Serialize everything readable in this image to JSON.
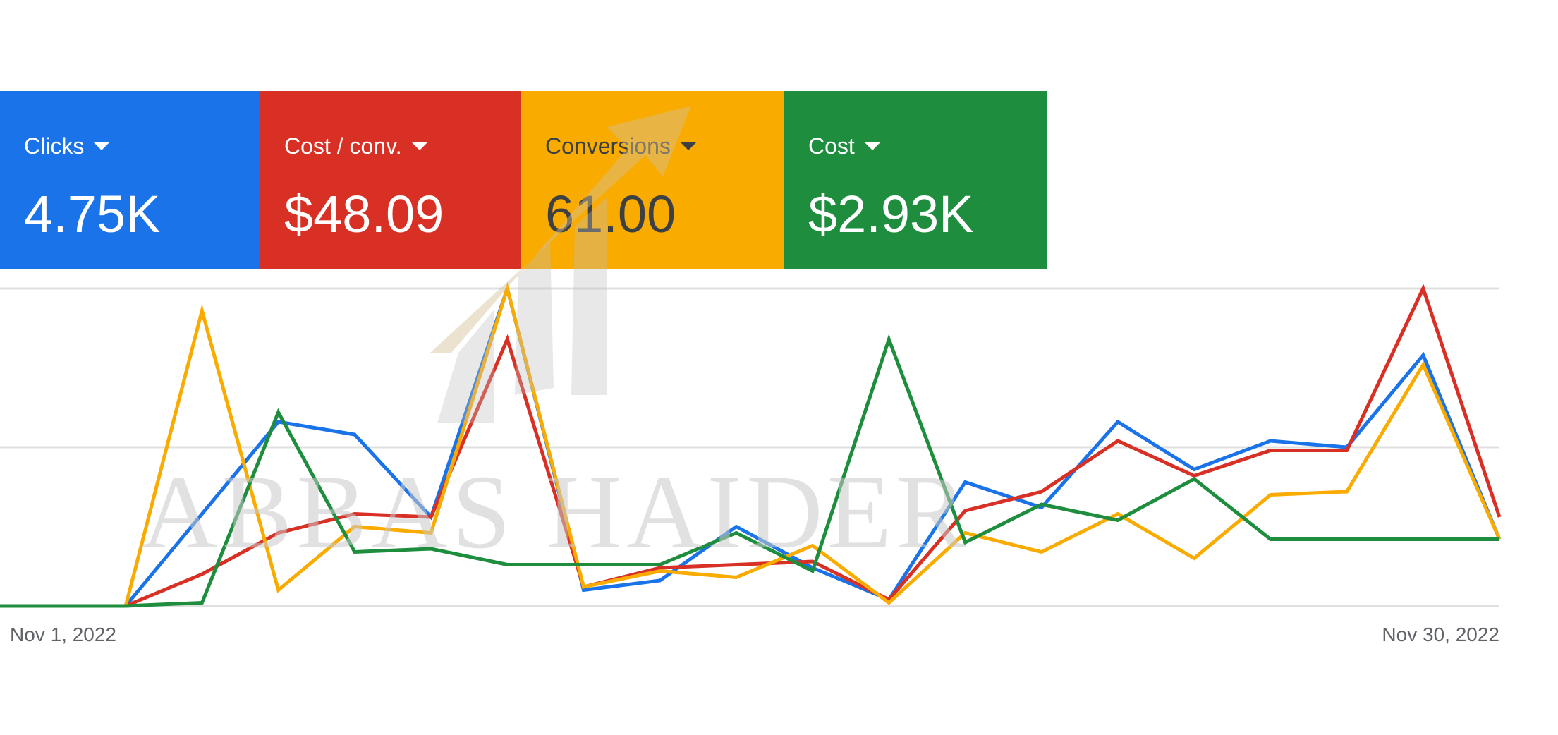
{
  "scorecards": [
    {
      "label": "Clicks",
      "value": "4.75K",
      "color": "#1a73e8",
      "text": "light"
    },
    {
      "label": "Cost / conv.",
      "value": "$48.09",
      "color": "#d93025",
      "text": "light"
    },
    {
      "label": "Conversions",
      "value": "61.00",
      "color": "#f9ab00",
      "text": "dark"
    },
    {
      "label": "Cost",
      "value": "$2.93K",
      "color": "#1e8e3e",
      "text": "light"
    }
  ],
  "watermark": "ABBAS HAIDER",
  "chart_data": {
    "type": "line",
    "x_start_label": "Nov 1, 2022",
    "x_end_label": "Nov 30, 2022",
    "ylim": [
      0,
      100
    ],
    "grid": true,
    "series": [
      {
        "color": "#1a73e8",
        "values": [
          0,
          0,
          29,
          58,
          54,
          28,
          100,
          5,
          8,
          25,
          12,
          2,
          39,
          31,
          58,
          43,
          52,
          50,
          79,
          21
        ]
      },
      {
        "color": "#d93025",
        "values": [
          0,
          0,
          10,
          23,
          29,
          28,
          84,
          6,
          12,
          13,
          14,
          2,
          30,
          36,
          52,
          41,
          49,
          49,
          100,
          28
        ]
      },
      {
        "color": "#f9ab00",
        "values": [
          0,
          0,
          93,
          5,
          25,
          23,
          100,
          6,
          11,
          9,
          19,
          1,
          23,
          17,
          29,
          15,
          35,
          36,
          76,
          21
        ]
      },
      {
        "color": "#1e8e3e",
        "values": [
          0,
          0,
          1,
          61,
          17,
          18,
          13,
          13,
          13,
          23,
          11,
          84,
          20,
          32,
          27,
          40,
          21,
          21,
          21,
          21
        ]
      }
    ]
  }
}
